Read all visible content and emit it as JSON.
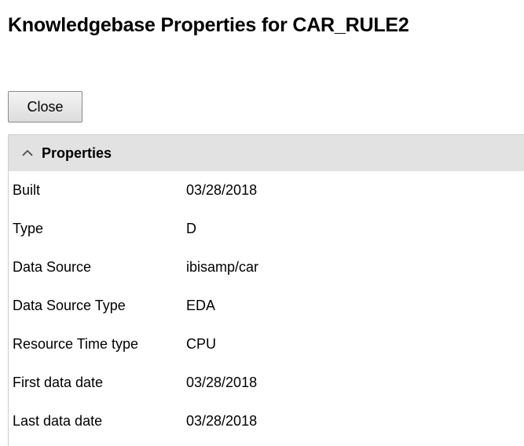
{
  "page": {
    "title": "Knowledgebase Properties for CAR_RULE2"
  },
  "toolbar": {
    "close_label": "Close"
  },
  "properties_panel": {
    "title": "Properties",
    "toggle_icon": "chevron-up-icon",
    "rows": [
      {
        "label": "Built",
        "value": "03/28/2018"
      },
      {
        "label": "Type",
        "value": "D"
      },
      {
        "label": "Data Source",
        "value": "ibisamp/car"
      },
      {
        "label": "Data Source Type",
        "value": "EDA"
      },
      {
        "label": "Resource Time type",
        "value": "CPU"
      },
      {
        "label": "First data date",
        "value": "03/28/2018"
      },
      {
        "label": "Last data date",
        "value": "03/28/2018"
      }
    ]
  },
  "colors": {
    "panel_header_bg": "#e2e2e2",
    "button_border": "#8a8a8a",
    "panel_border": "#cfcfcf"
  }
}
